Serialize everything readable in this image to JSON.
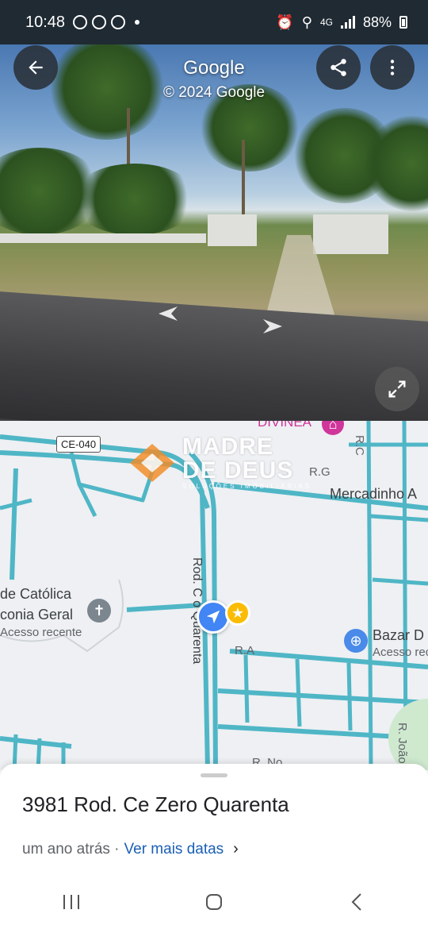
{
  "status_bar": {
    "time": "10:48",
    "battery": "88%",
    "network": "4G"
  },
  "street_view": {
    "title": "Google",
    "copyright": "© 2024 Google"
  },
  "map": {
    "road_shield": "CE-040",
    "poi_top": "DIVINEA",
    "road_r_g": "R.G",
    "road_r_c": "R.C",
    "shop_label": "Mercadinho A",
    "church_name_line1": "de Católica",
    "church_name_line2": "conia Geral",
    "church_sub": "Acesso recente",
    "highway_label": "Rod. C   o Quarenta",
    "road_r_a": "R.A",
    "bazar_name": "Bazar D",
    "bazar_sub": "Acesso rec",
    "road_r_joao": "R. João",
    "road_r_no": "R. No",
    "watermark_line1": "MADRE",
    "watermark_line2": "DE DEUS",
    "watermark_sub": "SOLUÇÕES IMOBILIÁRIAS"
  },
  "sheet": {
    "address": "3981 Rod. Ce Zero Quarenta",
    "date_text": "um ano atrás ·",
    "more_dates_link": "Ver mais datas"
  },
  "colors": {
    "road_stroke": "#4fb6c6",
    "link": "#1a5fb4",
    "location_blue": "#4285f4",
    "star_yellow": "#fbbc04",
    "watermark_orange": "#f28c28"
  }
}
